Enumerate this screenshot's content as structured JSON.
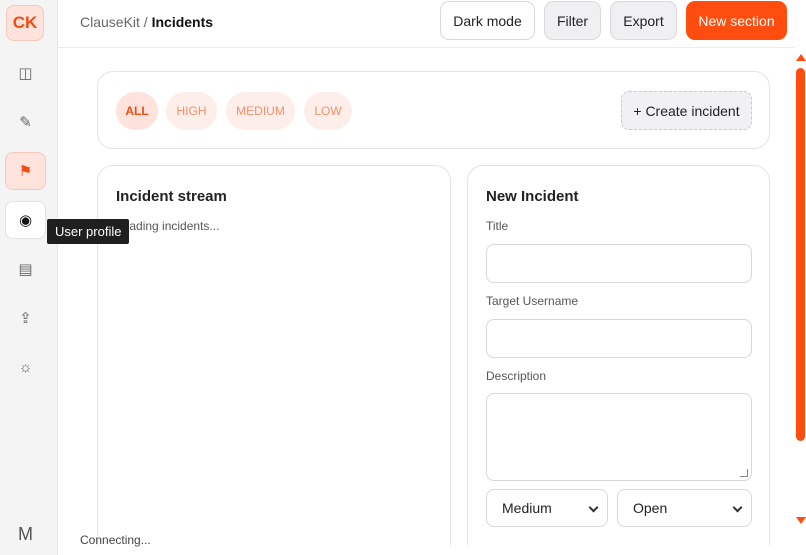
{
  "app": {
    "logo": "CK",
    "breadcrumb": {
      "root": "ClauseKit",
      "separator": " / ",
      "current": "Incidents"
    }
  },
  "sidebar": {
    "items": [
      {
        "name": "sidebar-toggle",
        "icon": "◫"
      },
      {
        "name": "edit",
        "icon": "✎"
      },
      {
        "name": "incidents",
        "icon": "⚑"
      },
      {
        "name": "user-profile",
        "icon": "◉"
      },
      {
        "name": "list",
        "icon": "▤"
      },
      {
        "name": "upload",
        "icon": "⇪"
      },
      {
        "name": "settings",
        "icon": "☼"
      }
    ],
    "avatar": "M",
    "tooltip": "User profile"
  },
  "header": {
    "dark_mode_label": "Dark mode",
    "filter_label": "Filter",
    "export_label": "Export",
    "new_section_label": "New section"
  },
  "filters": {
    "chips": [
      "ALL",
      "HIGH",
      "MEDIUM",
      "LOW"
    ],
    "active": "ALL",
    "create_label": "+ Create incident"
  },
  "stream": {
    "title": "Incident stream",
    "loading_text": "Loading incidents..."
  },
  "form": {
    "title": "New Incident",
    "title_label": "Title",
    "title_value": "",
    "target_label": "Target Username",
    "target_value": "",
    "description_label": "Description",
    "description_value": "",
    "severity_selected": "Medium",
    "status_selected": "Open"
  },
  "status_bar": {
    "text": "Connecting..."
  },
  "colors": {
    "accent": "#ff4d0f",
    "accent_soft": "#fde3dc"
  }
}
